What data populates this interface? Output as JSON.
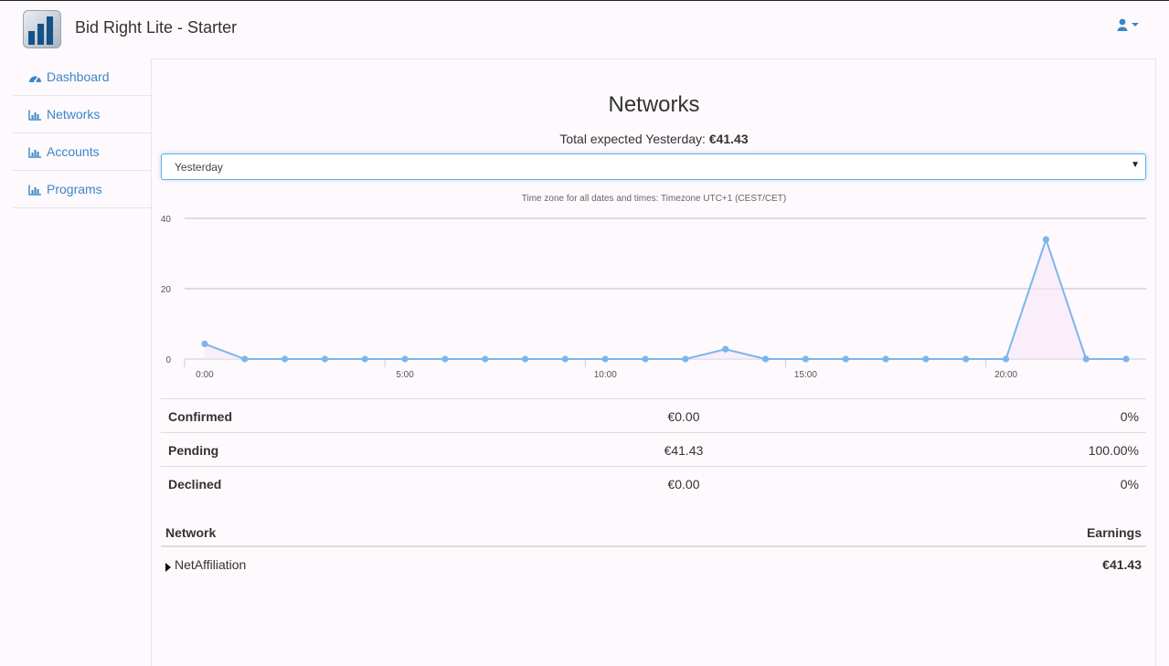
{
  "app": {
    "title": "Bid Right Lite - Starter"
  },
  "header": {
    "user_icon": "user-icon"
  },
  "sidebar": {
    "items": [
      {
        "label": "Dashboard",
        "icon": "dashboard-icon"
      },
      {
        "label": "Networks",
        "icon": "bar-chart-icon"
      },
      {
        "label": "Accounts",
        "icon": "bar-chart-icon"
      },
      {
        "label": "Programs",
        "icon": "bar-chart-icon"
      }
    ]
  },
  "main": {
    "title": "Networks",
    "total_label": "Total expected Yesterday: ",
    "total_value": "€41.43",
    "period_selected": "Yesterday",
    "timezone_note": "Time zone for all dates and times: Timezone UTC+1 (CEST/CET)"
  },
  "colors": {
    "line": "#7cb5ec",
    "link": "#3a87c8",
    "focus": "#66afe9"
  },
  "chart_data": {
    "type": "line",
    "x": [
      "0:00",
      "1:00",
      "2:00",
      "3:00",
      "4:00",
      "5:00",
      "6:00",
      "7:00",
      "8:00",
      "9:00",
      "10:00",
      "11:00",
      "12:00",
      "13:00",
      "14:00",
      "15:00",
      "16:00",
      "17:00",
      "18:00",
      "19:00",
      "20:00",
      "21:00",
      "22:00",
      "23:00"
    ],
    "x_tick_labels": [
      "0:00",
      "5:00",
      "10:00",
      "15:00",
      "20:00"
    ],
    "y_ticks": [
      0,
      20,
      40
    ],
    "ylim": [
      0,
      40
    ],
    "series": [
      {
        "values": [
          4.3,
          0,
          0,
          0,
          0,
          0,
          0,
          0,
          0,
          0,
          0,
          0,
          0,
          2.8,
          0,
          0,
          0,
          0,
          0,
          0,
          0,
          34,
          0,
          0
        ]
      }
    ],
    "grid": true
  },
  "summary": [
    {
      "label": "Confirmed",
      "value": "€0.00",
      "percent": "0%"
    },
    {
      "label": "Pending",
      "value": "€41.43",
      "percent": "100.00%"
    },
    {
      "label": "Declined",
      "value": "€0.00",
      "percent": "0%"
    }
  ],
  "network_table": {
    "headers": {
      "network": "Network",
      "earnings": "Earnings"
    },
    "rows": [
      {
        "network": "NetAffiliation",
        "earnings": "€41.43"
      }
    ]
  }
}
